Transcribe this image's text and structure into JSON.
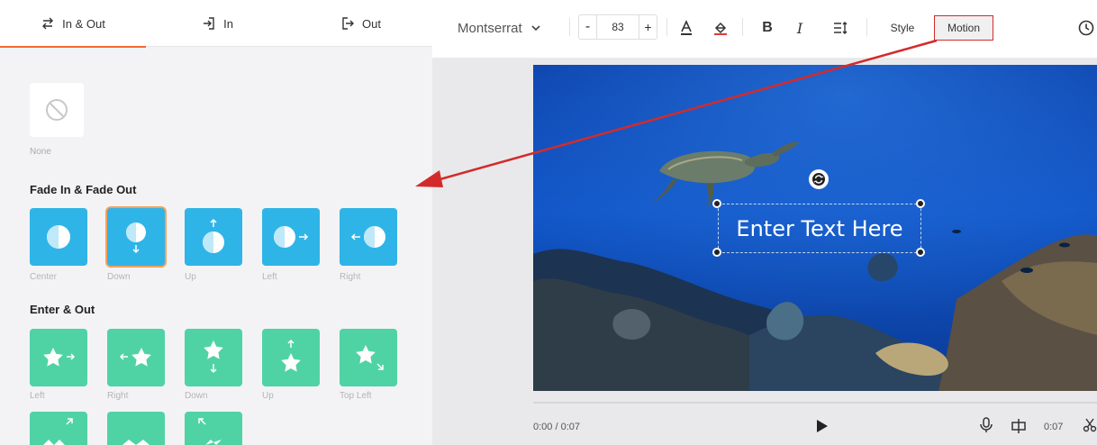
{
  "tabs": [
    {
      "label": "In & Out",
      "icon": "swap-arrows-icon",
      "active": true
    },
    {
      "label": "In",
      "icon": "enter-icon",
      "active": false
    },
    {
      "label": "Out",
      "icon": "exit-icon",
      "active": false
    }
  ],
  "none_option": {
    "label": "None",
    "icon": "prohibited-icon"
  },
  "sections": {
    "fade": {
      "title": "Fade In & Fade Out",
      "items": [
        {
          "label": "Center"
        },
        {
          "label": "Down",
          "selected": true
        },
        {
          "label": "Up"
        },
        {
          "label": "Left"
        },
        {
          "label": "Right"
        }
      ]
    },
    "enter": {
      "title": "Enter & Out",
      "items": [
        {
          "label": "Left"
        },
        {
          "label": "Right"
        },
        {
          "label": "Down"
        },
        {
          "label": "Up"
        },
        {
          "label": "Top Left"
        }
      ]
    }
  },
  "toolbar": {
    "font": "Montserrat",
    "size_minus": "-",
    "size": "83",
    "size_plus": "+",
    "text_color_glyph": "A",
    "bold": "B",
    "italic": "I",
    "style": "Style",
    "motion": "Motion"
  },
  "canvas": {
    "text": "Enter Text Here"
  },
  "playback": {
    "time": "0:00 / 0:07",
    "duration": "0:07"
  },
  "colors": {
    "accent": "#f26a2e",
    "fade_tile": "#2fb4e7",
    "enter_tile": "#4fd3a4",
    "annotation": "#d32b2b"
  }
}
